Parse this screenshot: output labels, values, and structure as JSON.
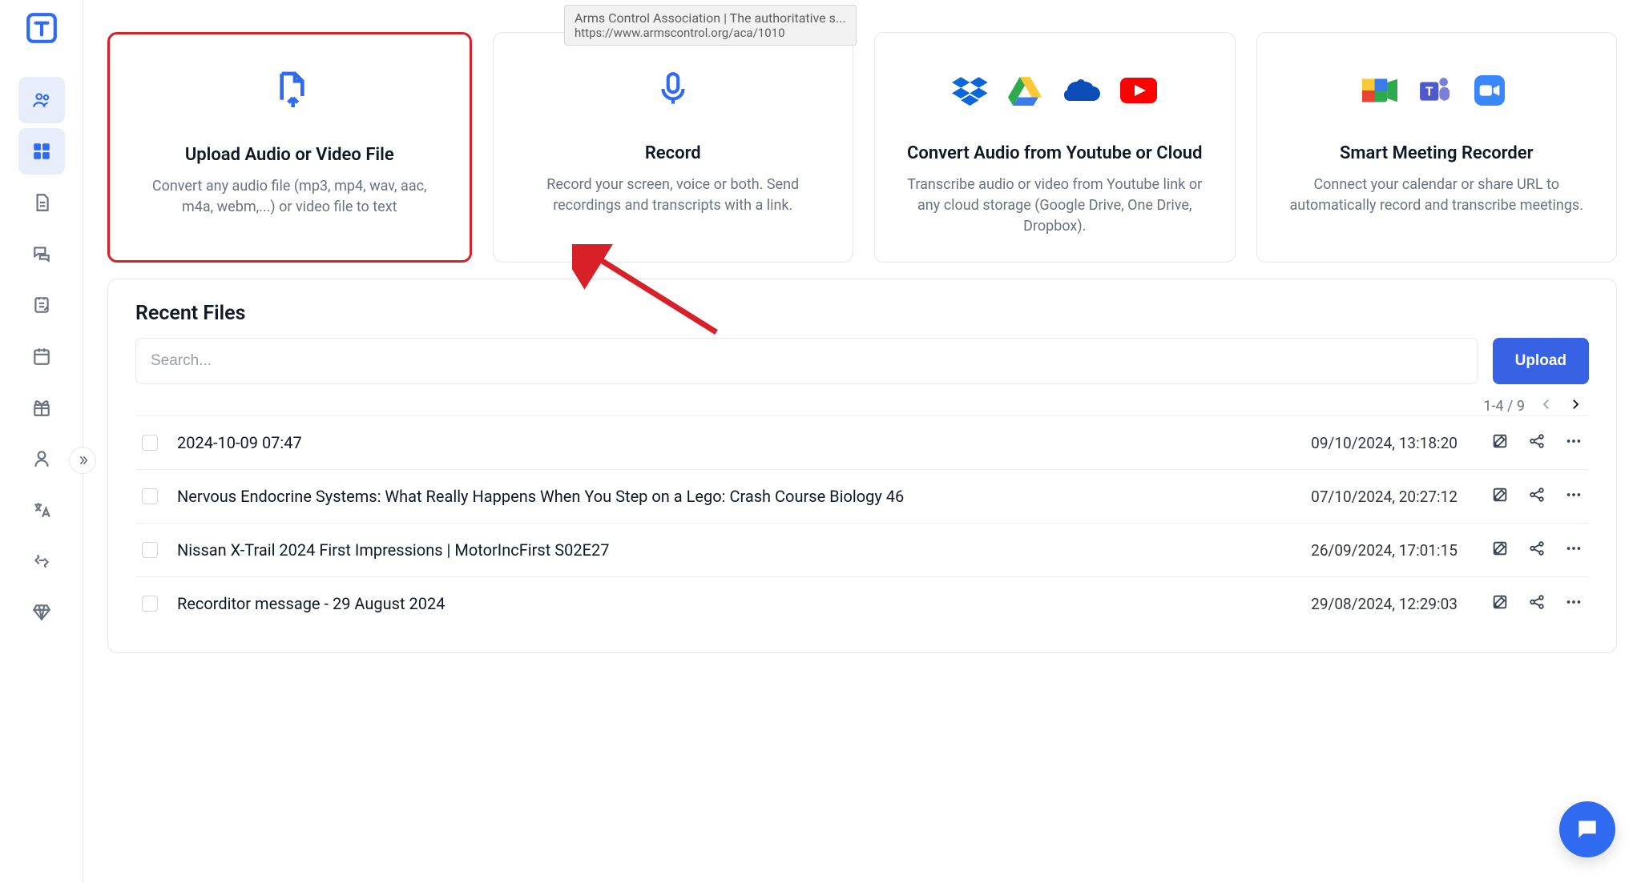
{
  "tooltip": {
    "title": "Arms Control Association | The authoritative s...",
    "url": "https://www.armscontrol.org/aca/1010"
  },
  "cards": {
    "upload": {
      "title": "Upload Audio or Video File",
      "desc": "Convert any audio file (mp3, mp4, wav, aac, m4a, webm,...) or video file to text"
    },
    "record": {
      "title": "Record",
      "desc": "Record your screen, voice or both. Send recordings and transcripts with a link."
    },
    "cloud": {
      "title": "Convert Audio from Youtube or Cloud",
      "desc": "Transcribe audio or video from Youtube link or any cloud storage (Google Drive, One Drive, Dropbox)."
    },
    "meeting": {
      "title": "Smart Meeting Recorder",
      "desc": "Connect your calendar or share URL to automatically record and transcribe meetings."
    }
  },
  "recent": {
    "heading": "Recent Files",
    "search_placeholder": "Search...",
    "upload_label": "Upload",
    "page_info": "1-4 / 9",
    "files": [
      {
        "name": "2024-10-09 07:47",
        "date": "09/10/2024, 13:18:20"
      },
      {
        "name": "Nervous Endocrine Systems: What Really Happens When You Step on a Lego: Crash Course Biology 46",
        "date": "07/10/2024, 20:27:12"
      },
      {
        "name": "Nissan X-Trail 2024 First Impressions | MotorIncFirst S02E27",
        "date": "26/09/2024, 17:01:15"
      },
      {
        "name": "Recorditor message - 29 August 2024",
        "date": "29/08/2024, 12:29:03"
      }
    ]
  }
}
